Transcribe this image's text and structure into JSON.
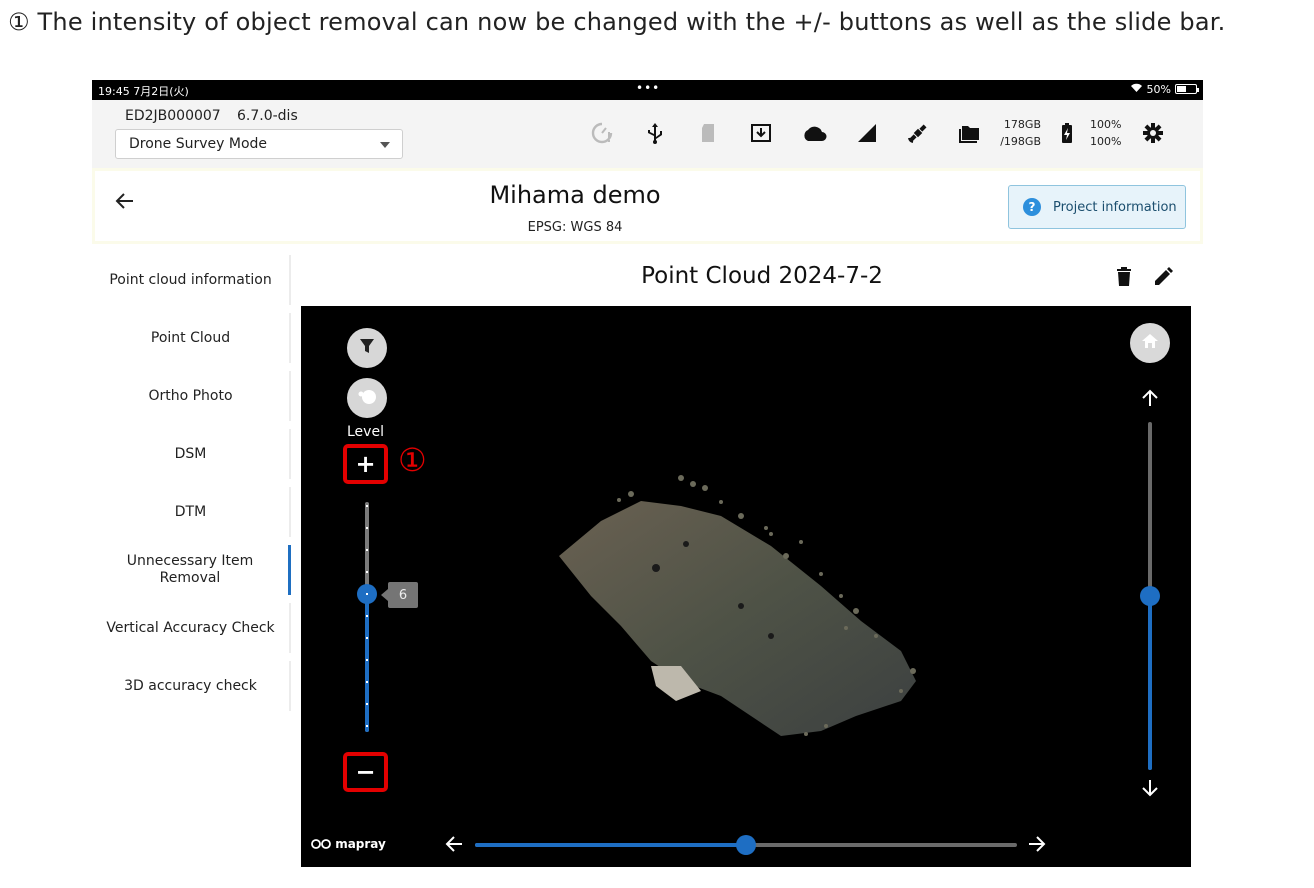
{
  "caption": "① The intensity of  object removal can now be changed with the +/- buttons as well as the slide bar.",
  "status_bar": {
    "time": "19:45  7月2日(火)",
    "dots": "•••",
    "battery": "50%"
  },
  "toolbar": {
    "device_id": "ED2JB000007",
    "firmware": "6.7.0-dis",
    "mode_value": "Drone Survey Mode",
    "storage_used": "178GB",
    "storage_total": "/198GB",
    "battery_1": "100%",
    "battery_2": "100%"
  },
  "project": {
    "title": "Mihama demo",
    "epsg": "EPSG: WGS 84",
    "info_button": "Project information"
  },
  "sidebar": {
    "items": [
      {
        "label": "Point cloud information",
        "active": false
      },
      {
        "label": "Point Cloud",
        "active": false
      },
      {
        "label": "Ortho Photo",
        "active": false
      },
      {
        "label": "DSM",
        "active": false
      },
      {
        "label": "DTM",
        "active": false
      },
      {
        "label": "Unnecessary Item Removal",
        "active": true
      },
      {
        "label": "Vertical Accuracy Check",
        "active": false
      },
      {
        "label": "3D accuracy check",
        "active": false
      }
    ]
  },
  "main": {
    "title": "Point Cloud 2024-7-2"
  },
  "viewer": {
    "level_label": "Level",
    "plus_label": "+",
    "minus_label": "−",
    "marker": "①",
    "level_value": "6",
    "logo_text": "mapray",
    "accent_color": "#1e6ec3",
    "highlight_color": "#e30000",
    "level_slider_fraction": 0.6,
    "vertical_slider_fraction": 0.5,
    "horizontal_slider_fraction": 0.5
  }
}
